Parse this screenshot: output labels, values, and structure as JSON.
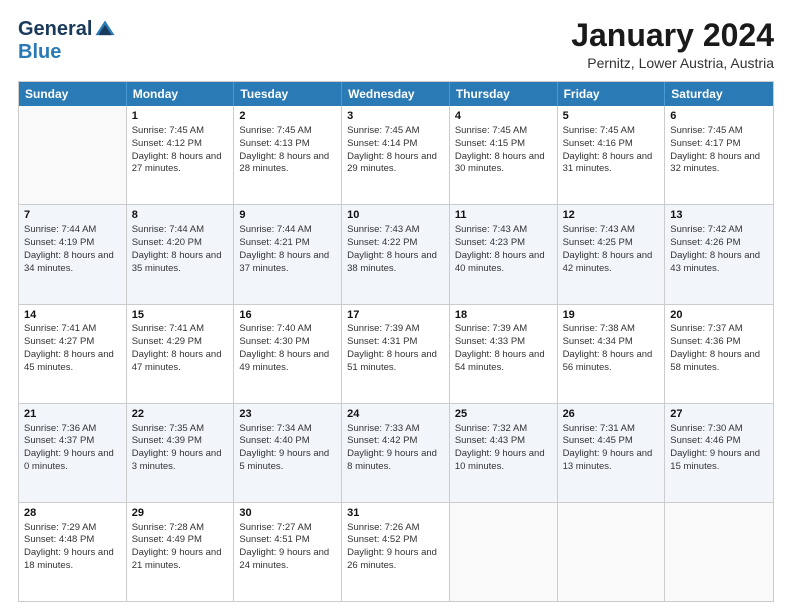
{
  "header": {
    "logo_general": "General",
    "logo_blue": "Blue",
    "title": "January 2024",
    "location": "Pernitz, Lower Austria, Austria"
  },
  "days_of_week": [
    "Sunday",
    "Monday",
    "Tuesday",
    "Wednesday",
    "Thursday",
    "Friday",
    "Saturday"
  ],
  "weeks": [
    [
      {
        "day": "",
        "sunrise": "",
        "sunset": "",
        "daylight": "",
        "empty": true
      },
      {
        "day": "1",
        "sunrise": "Sunrise: 7:45 AM",
        "sunset": "Sunset: 4:12 PM",
        "daylight": "Daylight: 8 hours and 27 minutes."
      },
      {
        "day": "2",
        "sunrise": "Sunrise: 7:45 AM",
        "sunset": "Sunset: 4:13 PM",
        "daylight": "Daylight: 8 hours and 28 minutes."
      },
      {
        "day": "3",
        "sunrise": "Sunrise: 7:45 AM",
        "sunset": "Sunset: 4:14 PM",
        "daylight": "Daylight: 8 hours and 29 minutes."
      },
      {
        "day": "4",
        "sunrise": "Sunrise: 7:45 AM",
        "sunset": "Sunset: 4:15 PM",
        "daylight": "Daylight: 8 hours and 30 minutes."
      },
      {
        "day": "5",
        "sunrise": "Sunrise: 7:45 AM",
        "sunset": "Sunset: 4:16 PM",
        "daylight": "Daylight: 8 hours and 31 minutes."
      },
      {
        "day": "6",
        "sunrise": "Sunrise: 7:45 AM",
        "sunset": "Sunset: 4:17 PM",
        "daylight": "Daylight: 8 hours and 32 minutes."
      }
    ],
    [
      {
        "day": "7",
        "sunrise": "Sunrise: 7:44 AM",
        "sunset": "Sunset: 4:19 PM",
        "daylight": "Daylight: 8 hours and 34 minutes."
      },
      {
        "day": "8",
        "sunrise": "Sunrise: 7:44 AM",
        "sunset": "Sunset: 4:20 PM",
        "daylight": "Daylight: 8 hours and 35 minutes."
      },
      {
        "day": "9",
        "sunrise": "Sunrise: 7:44 AM",
        "sunset": "Sunset: 4:21 PM",
        "daylight": "Daylight: 8 hours and 37 minutes."
      },
      {
        "day": "10",
        "sunrise": "Sunrise: 7:43 AM",
        "sunset": "Sunset: 4:22 PM",
        "daylight": "Daylight: 8 hours and 38 minutes."
      },
      {
        "day": "11",
        "sunrise": "Sunrise: 7:43 AM",
        "sunset": "Sunset: 4:23 PM",
        "daylight": "Daylight: 8 hours and 40 minutes."
      },
      {
        "day": "12",
        "sunrise": "Sunrise: 7:43 AM",
        "sunset": "Sunset: 4:25 PM",
        "daylight": "Daylight: 8 hours and 42 minutes."
      },
      {
        "day": "13",
        "sunrise": "Sunrise: 7:42 AM",
        "sunset": "Sunset: 4:26 PM",
        "daylight": "Daylight: 8 hours and 43 minutes."
      }
    ],
    [
      {
        "day": "14",
        "sunrise": "Sunrise: 7:41 AM",
        "sunset": "Sunset: 4:27 PM",
        "daylight": "Daylight: 8 hours and 45 minutes."
      },
      {
        "day": "15",
        "sunrise": "Sunrise: 7:41 AM",
        "sunset": "Sunset: 4:29 PM",
        "daylight": "Daylight: 8 hours and 47 minutes."
      },
      {
        "day": "16",
        "sunrise": "Sunrise: 7:40 AM",
        "sunset": "Sunset: 4:30 PM",
        "daylight": "Daylight: 8 hours and 49 minutes."
      },
      {
        "day": "17",
        "sunrise": "Sunrise: 7:39 AM",
        "sunset": "Sunset: 4:31 PM",
        "daylight": "Daylight: 8 hours and 51 minutes."
      },
      {
        "day": "18",
        "sunrise": "Sunrise: 7:39 AM",
        "sunset": "Sunset: 4:33 PM",
        "daylight": "Daylight: 8 hours and 54 minutes."
      },
      {
        "day": "19",
        "sunrise": "Sunrise: 7:38 AM",
        "sunset": "Sunset: 4:34 PM",
        "daylight": "Daylight: 8 hours and 56 minutes."
      },
      {
        "day": "20",
        "sunrise": "Sunrise: 7:37 AM",
        "sunset": "Sunset: 4:36 PM",
        "daylight": "Daylight: 8 hours and 58 minutes."
      }
    ],
    [
      {
        "day": "21",
        "sunrise": "Sunrise: 7:36 AM",
        "sunset": "Sunset: 4:37 PM",
        "daylight": "Daylight: 9 hours and 0 minutes."
      },
      {
        "day": "22",
        "sunrise": "Sunrise: 7:35 AM",
        "sunset": "Sunset: 4:39 PM",
        "daylight": "Daylight: 9 hours and 3 minutes."
      },
      {
        "day": "23",
        "sunrise": "Sunrise: 7:34 AM",
        "sunset": "Sunset: 4:40 PM",
        "daylight": "Daylight: 9 hours and 5 minutes."
      },
      {
        "day": "24",
        "sunrise": "Sunrise: 7:33 AM",
        "sunset": "Sunset: 4:42 PM",
        "daylight": "Daylight: 9 hours and 8 minutes."
      },
      {
        "day": "25",
        "sunrise": "Sunrise: 7:32 AM",
        "sunset": "Sunset: 4:43 PM",
        "daylight": "Daylight: 9 hours and 10 minutes."
      },
      {
        "day": "26",
        "sunrise": "Sunrise: 7:31 AM",
        "sunset": "Sunset: 4:45 PM",
        "daylight": "Daylight: 9 hours and 13 minutes."
      },
      {
        "day": "27",
        "sunrise": "Sunrise: 7:30 AM",
        "sunset": "Sunset: 4:46 PM",
        "daylight": "Daylight: 9 hours and 15 minutes."
      }
    ],
    [
      {
        "day": "28",
        "sunrise": "Sunrise: 7:29 AM",
        "sunset": "Sunset: 4:48 PM",
        "daylight": "Daylight: 9 hours and 18 minutes."
      },
      {
        "day": "29",
        "sunrise": "Sunrise: 7:28 AM",
        "sunset": "Sunset: 4:49 PM",
        "daylight": "Daylight: 9 hours and 21 minutes."
      },
      {
        "day": "30",
        "sunrise": "Sunrise: 7:27 AM",
        "sunset": "Sunset: 4:51 PM",
        "daylight": "Daylight: 9 hours and 24 minutes."
      },
      {
        "day": "31",
        "sunrise": "Sunrise: 7:26 AM",
        "sunset": "Sunset: 4:52 PM",
        "daylight": "Daylight: 9 hours and 26 minutes."
      },
      {
        "day": "",
        "sunrise": "",
        "sunset": "",
        "daylight": "",
        "empty": true
      },
      {
        "day": "",
        "sunrise": "",
        "sunset": "",
        "daylight": "",
        "empty": true
      },
      {
        "day": "",
        "sunrise": "",
        "sunset": "",
        "daylight": "",
        "empty": true
      }
    ]
  ]
}
